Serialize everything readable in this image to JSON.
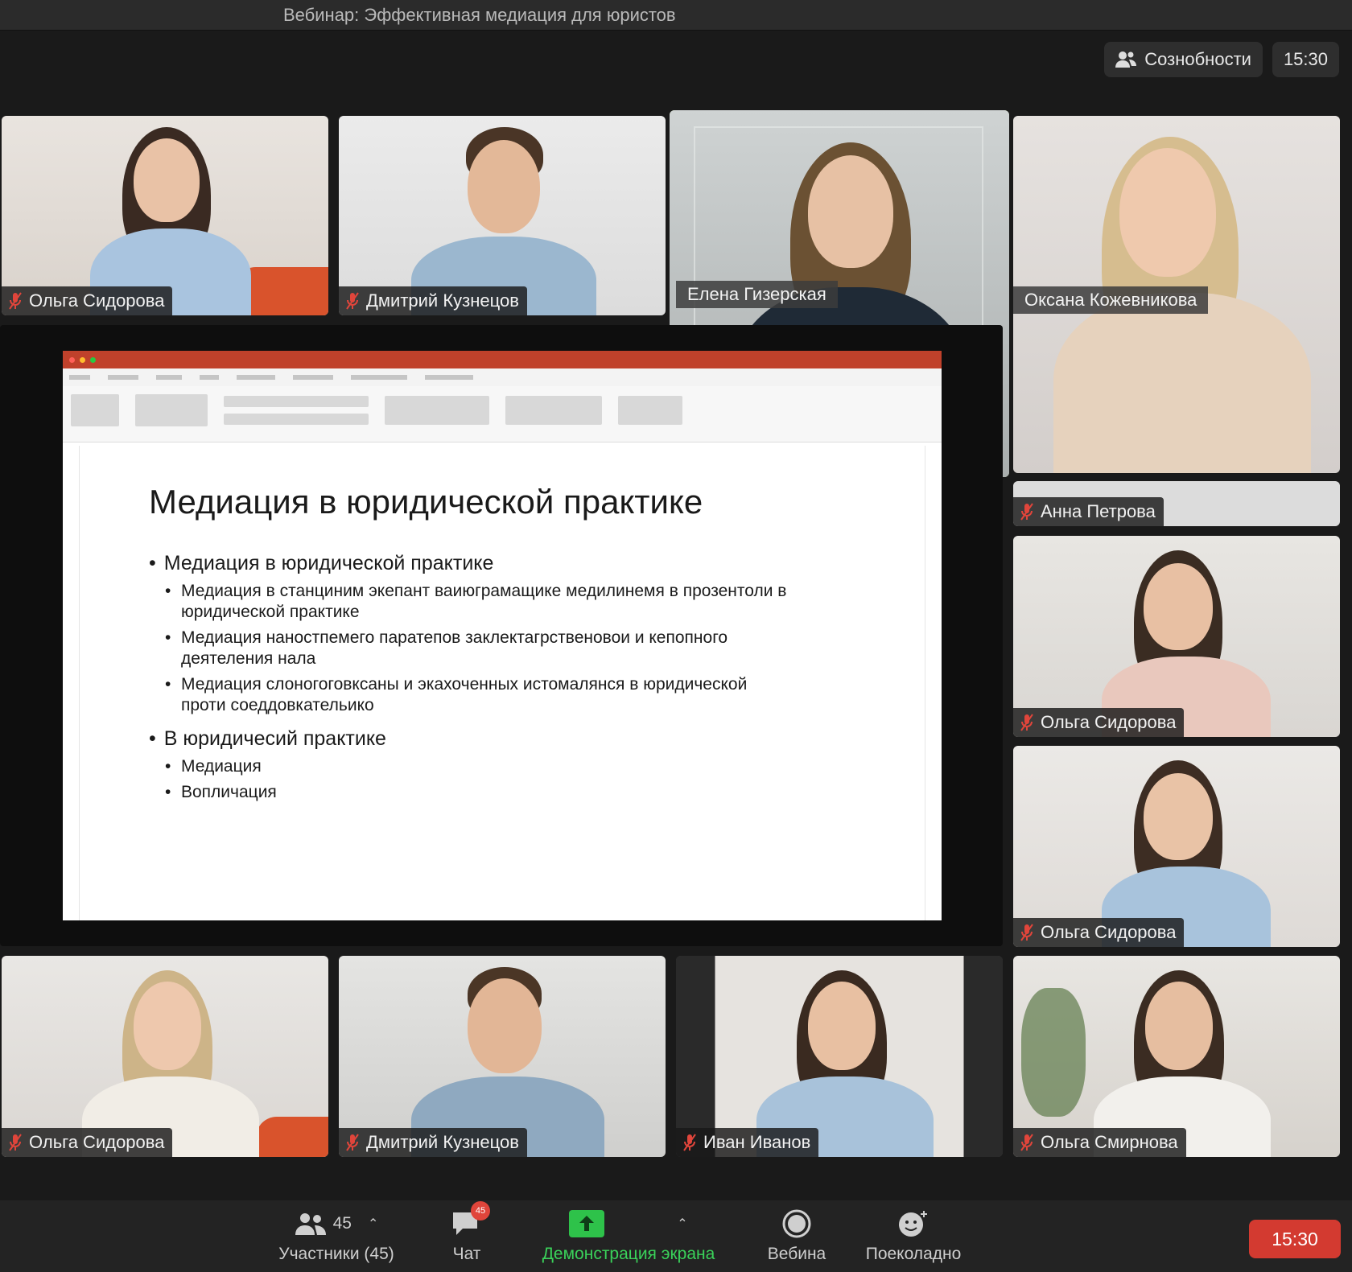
{
  "window": {
    "title": "Вебинар: Эффективная медиация для юристов"
  },
  "top_controls": {
    "participants_label": "Сознобности",
    "clock": "15:30"
  },
  "tiles": [
    {
      "name": "Ольга Сидорова",
      "muted": true
    },
    {
      "name": "Дмитрий Кузнецов",
      "muted": true
    },
    {
      "name": "Елена Гизерская",
      "muted": false,
      "active_speaker": true
    },
    {
      "name": "Оксана Кожевникова",
      "muted": false
    },
    {
      "name": "Анна Петрова",
      "muted": true
    },
    {
      "name": "Ольга Сидорова",
      "muted": true
    },
    {
      "name": "Ольга Сидорова",
      "muted": true
    },
    {
      "name": "Ольга Сидорова",
      "muted": true
    },
    {
      "name": "Дмитрий Кузнецов",
      "muted": true
    },
    {
      "name": "Иван Иванов",
      "muted": true
    },
    {
      "name": "Ольга Смирнова",
      "muted": true
    }
  ],
  "slide": {
    "title": "Медиация в юридической практике",
    "bullets": [
      "Медиация в юридической практике",
      "Медиация в станциним экепант ваиюграмащике медилинемя в прозентоли в юридической практике",
      "Медиация наностпемего паратепов заклектагрственовои и кепопного деятеления нала",
      "Медиация слоногоговксаны и экахоченных истомалянся в юридической проти соеддовкательико",
      "В юридичесий практике",
      "Медиация",
      "Вопличация"
    ]
  },
  "toolbar": {
    "participants_count": "45",
    "participants_label": "Участники (45)",
    "chat_label": "Чат",
    "chat_badge": "45",
    "share_label": "Демонстрация экрана",
    "webinar_label": "Вебина",
    "reactions_label": "Поеколадно",
    "end_time": "15:30"
  },
  "colors": {
    "active_border": "#c6e28f",
    "share_green": "#2ec24a",
    "end_red": "#d33a30",
    "mute_red": "#e0453b"
  }
}
